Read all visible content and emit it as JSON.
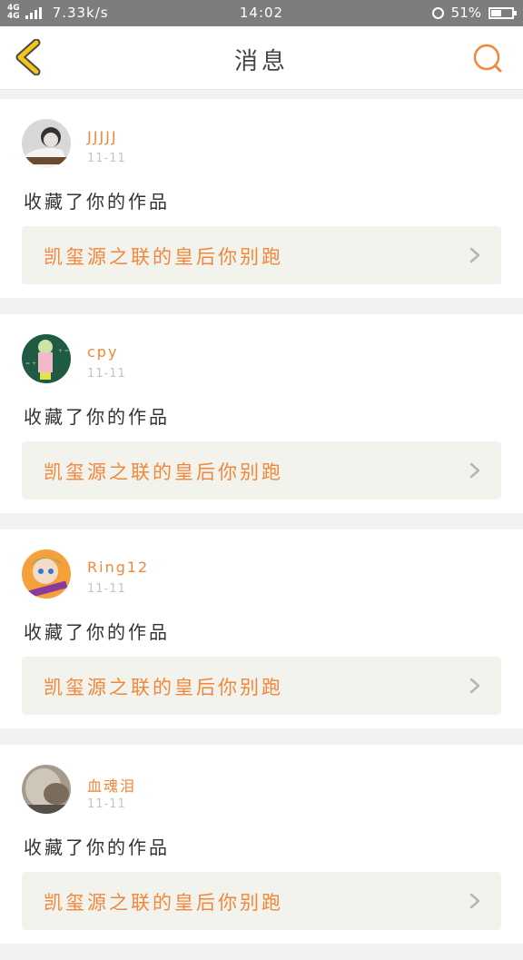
{
  "status_bar": {
    "network": "4G",
    "network2": "4G",
    "speed": "7.33k/s",
    "time": "14:02",
    "battery": "51%",
    "battery_level": 0.51
  },
  "header": {
    "title": "消息",
    "back_icon": "chevron-left-icon",
    "search_icon": "search-icon"
  },
  "colors": {
    "accent": "#f0873a",
    "back_icon": "#f5c518"
  },
  "messages": [
    {
      "username": "JJJJJ",
      "date": "11-11",
      "action": "收藏了你的作品",
      "work_title": "凯玺源之联的皇后你别跑"
    },
    {
      "username": "cpy",
      "date": "11-11",
      "action": "收藏了你的作品",
      "work_title": "凯玺源之联的皇后你别跑"
    },
    {
      "username": "Ring12",
      "date": "11-11",
      "action": "收藏了你的作品",
      "work_title": "凯玺源之联的皇后你别跑"
    },
    {
      "username": "血魂泪",
      "date": "11-11",
      "action": "收藏了你的作品",
      "work_title": "凯玺源之联的皇后你别跑"
    }
  ]
}
